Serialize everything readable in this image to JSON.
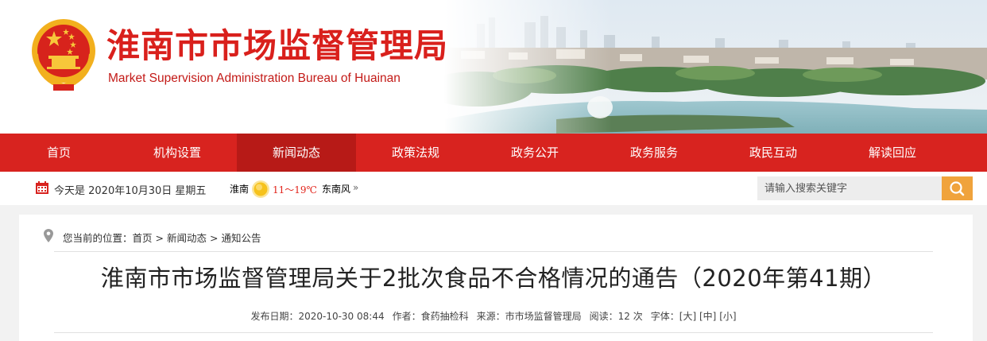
{
  "header": {
    "title_cn": "淮南市市场监督管理局",
    "title_en": "Market Supervision Administration Bureau of Huainan",
    "brand_red": "#d9201c"
  },
  "nav": {
    "items": [
      {
        "label": "首页"
      },
      {
        "label": "机构设置"
      },
      {
        "label": "新闻动态"
      },
      {
        "label": "政策法规"
      },
      {
        "label": "政务公开"
      },
      {
        "label": "政务服务"
      },
      {
        "label": "政民互动"
      },
      {
        "label": "解读回应"
      }
    ],
    "active_label": "新闻动态",
    "bg_color": "#d8231f",
    "active_color": "#b71a17"
  },
  "infobar": {
    "today": "今天是 2020年10月30日 星期五",
    "weather_city": "淮南",
    "weather_icon": "sun-icon",
    "temperature": "11～19℃",
    "wind": "东南风",
    "more_icon": "double-chevron-right-icon",
    "search_placeholder": "请输入搜索关键字",
    "search_icon": "search-icon",
    "search_btn_color": "#f0a33c"
  },
  "breadcrumb": {
    "prefix": "您当前的位置：",
    "items": [
      "首页",
      "新闻动态",
      "通知公告"
    ],
    "separator": ">"
  },
  "article": {
    "title": "淮南市市场监督管理局关于2批次食品不合格情况的通告（2020年第41期）",
    "date_label": "发布日期：",
    "date": "2020-10-30 08:44",
    "author_label": "作者：",
    "author": "食药抽检科",
    "source_label": "来源：",
    "source": "市市场监督管理局",
    "views_label": "阅读：",
    "views": "12 次",
    "fontsize_label": "字体：",
    "fontsize_large": "[大]",
    "fontsize_medium": "[中]",
    "fontsize_small": "[小]"
  }
}
